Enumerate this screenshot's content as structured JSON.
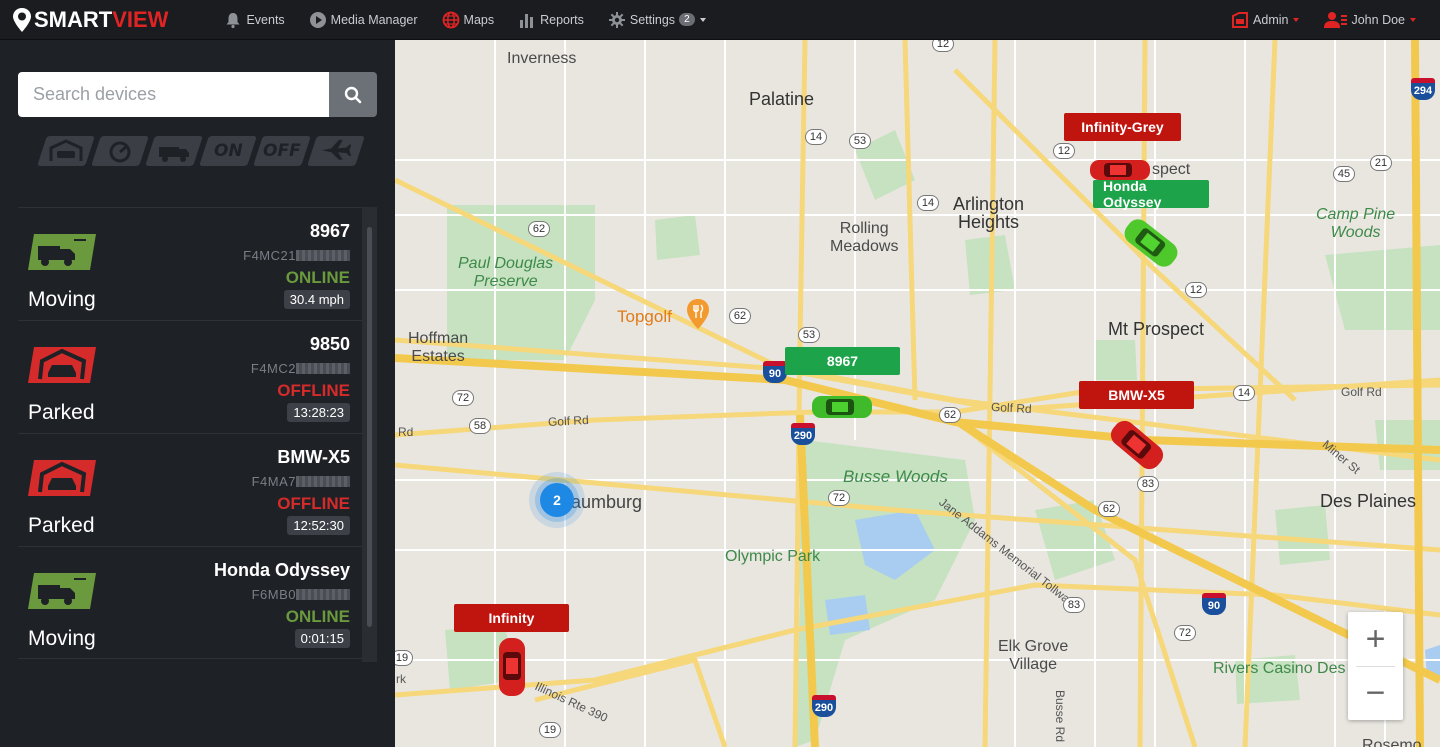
{
  "header": {
    "logo_part1": "SMART",
    "logo_part2": "VIEW",
    "nav": [
      {
        "label": "Events",
        "icon": "bell-icon"
      },
      {
        "label": "Media Manager",
        "icon": "play-icon"
      },
      {
        "label": "Maps",
        "icon": "globe-icon"
      },
      {
        "label": "Reports",
        "icon": "bar-chart-icon"
      },
      {
        "label": "Settings",
        "icon": "gear-icon",
        "badge": "2"
      }
    ],
    "admin_label": "Admin",
    "user_label": "John Doe"
  },
  "sidebar": {
    "search_placeholder": "Search devices",
    "filters": [
      "moving-filter",
      "idle-filter",
      "parked-filter",
      "ON",
      "OFF",
      "flight-filter"
    ],
    "devices": [
      {
        "name": "8967",
        "device_id": "F4MC21",
        "connection": "ONLINE",
        "state": "Moving",
        "value": "30.4 mph",
        "status": "online"
      },
      {
        "name": "9850",
        "device_id": "F4MC2",
        "connection": "OFFLINE",
        "state": "Parked",
        "value": "13:28:23",
        "status": "offline"
      },
      {
        "name": "BMW-X5",
        "device_id": "F4MA7",
        "connection": "OFFLINE",
        "state": "Parked",
        "value": "12:52:30",
        "status": "offline"
      },
      {
        "name": "Honda Odyssey",
        "device_id": "F6MB0",
        "connection": "ONLINE",
        "state": "Moving",
        "value": "0:01:15",
        "status": "online"
      }
    ]
  },
  "map": {
    "places": {
      "inverness": "Inverness",
      "palatine": "Palatine",
      "arlington1": "Arlington",
      "arlington2": "Heights",
      "rolling1": "Rolling",
      "rolling2": "Meadows",
      "paul1": "Paul Douglas",
      "paul2": "Preserve",
      "topgolf": "Topgolf",
      "hoffman1": "Hoffman",
      "hoffman2": "Estates",
      "mtprospect": "Mt Prospect",
      "prospect": "spect",
      "camppine1": "Camp Pine",
      "camppine2": "Woods",
      "busse": "Busse Woods",
      "schaumburg": "Schaumburg",
      "olympic": "Olympic Park",
      "desplaines": "Des Plaines",
      "elkgrove1": "Elk Grove",
      "elkgrove2": "Village",
      "rivers": "Rivers Casino Des Plaines",
      "golfrd1": "Golf Rd",
      "golfrd2": "Golf Rd",
      "golfrd3": "Golf Rd",
      "rd": "Rd",
      "rk": "rk",
      "illinois": "Illinois Rte 390",
      "jane": "Jane Addams Memorial Tollway",
      "minerst": "Miner St",
      "busserd": "Busse Rd",
      "rosemont": "Rosemo"
    },
    "shields": [
      "12",
      "14",
      "53",
      "12",
      "14",
      "62",
      "62",
      "53",
      "72",
      "58",
      "62",
      "72",
      "62",
      "83",
      "83",
      "72",
      "19",
      "19",
      "14",
      "45",
      "21",
      "12"
    ],
    "interstates": [
      "90",
      "290",
      "90",
      "290",
      "294"
    ],
    "vehicles": [
      {
        "label": "Infinity-Grey",
        "color": "red"
      },
      {
        "label": "Honda Odyssey",
        "color": "green"
      },
      {
        "label": "8967",
        "color": "green"
      },
      {
        "label": "BMW-X5",
        "color": "red"
      },
      {
        "label": "Infinity",
        "color": "red"
      }
    ],
    "cluster_count": "2",
    "zoom_in": "+",
    "zoom_out": "−"
  },
  "colors": {
    "accent_red": "#e02424",
    "online_green": "#6a9a3d",
    "offline_red": "#d62b2b"
  }
}
